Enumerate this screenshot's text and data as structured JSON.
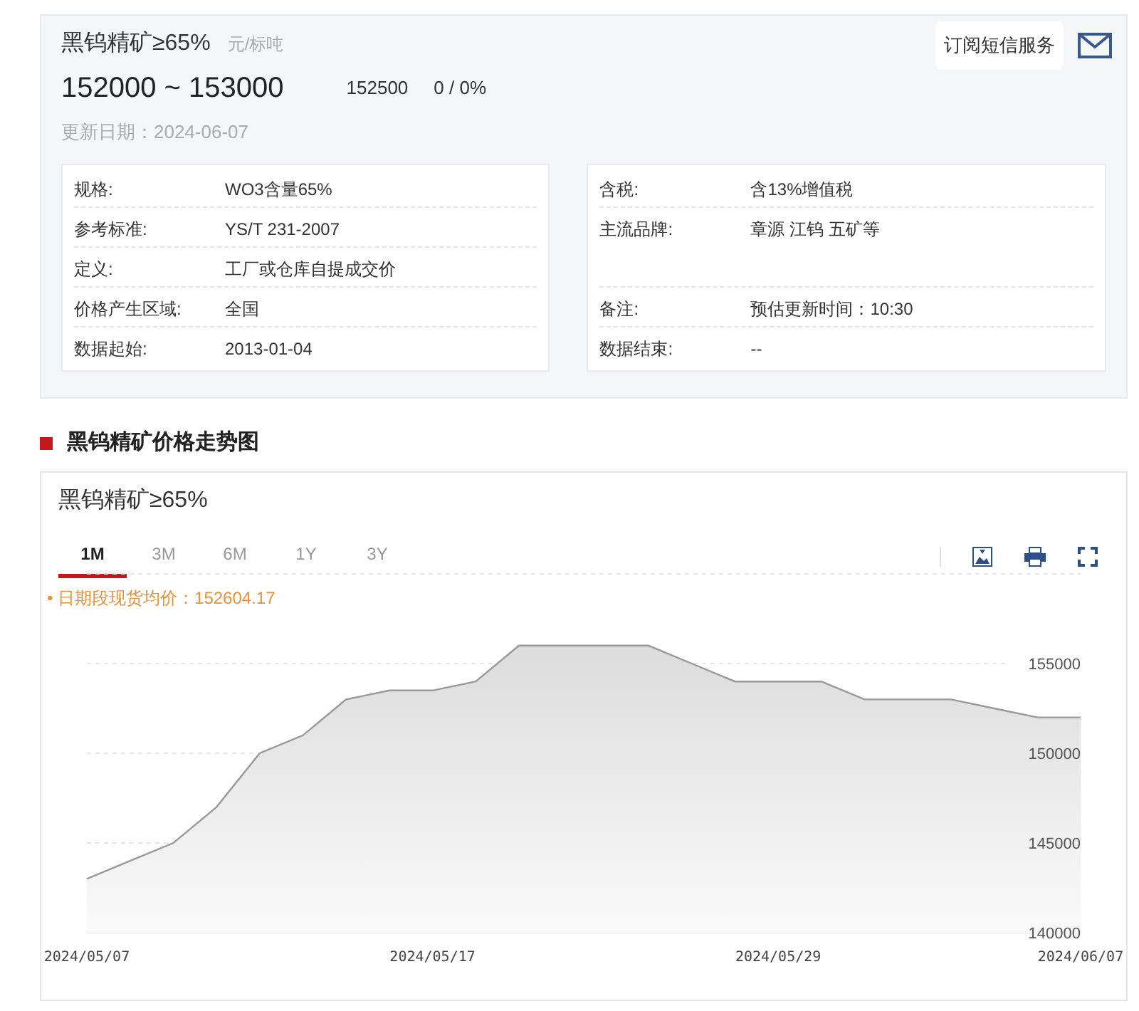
{
  "header": {
    "title": "黑钨精矿≥65%",
    "unit": "元/标吨",
    "price_range": "152000 ~ 153000",
    "average": "152500",
    "change": "0 / 0%",
    "updated": "更新日期：2024-06-07",
    "subscribe_button": "订阅短信服务"
  },
  "info_left": [
    {
      "label": "规格:",
      "value": "WO3含量65%"
    },
    {
      "label": "参考标准:",
      "value": "YS/T 231-2007"
    },
    {
      "label": "定义:",
      "value": "工厂或仓库自提成交价"
    },
    {
      "label": "价格产生区域:",
      "value": "全国"
    },
    {
      "label": "数据起始:",
      "value": "2013-01-04"
    }
  ],
  "info_right": [
    {
      "label": "含税:",
      "value": "含13%增值税",
      "kind": "normal"
    },
    {
      "label": "主流品牌:",
      "value": "章源 江钨 五矿等",
      "kind": "tall"
    },
    {
      "label": "备注:",
      "value": "预估更新时间：10:30",
      "kind": "normal"
    },
    {
      "label": "数据结束:",
      "value": "--",
      "kind": "normal"
    }
  ],
  "section_title": "黑钨精矿价格走势图",
  "chart_panel": {
    "title": "黑钨精矿≥65%",
    "tabs": [
      {
        "label": "1M",
        "selected": true
      },
      {
        "label": "3M",
        "selected": false
      },
      {
        "label": "6M",
        "selected": false
      },
      {
        "label": "1Y",
        "selected": false
      },
      {
        "label": "3Y",
        "selected": false
      }
    ],
    "average_note": "• 日期段现货均价：152604.17",
    "chart_data": {
      "type": "area",
      "categories": [
        "2024/05/07",
        null,
        null,
        null,
        null,
        null,
        null,
        null,
        "2024/05/17",
        null,
        null,
        null,
        null,
        null,
        null,
        null,
        "2024/05/29",
        null,
        null,
        null,
        null,
        null,
        null,
        "2024/06/07"
      ],
      "series": [
        {
          "color": "#999999",
          "values": [
            143000,
            144000,
            145000,
            147000,
            150000,
            151000,
            153000,
            153500,
            153500,
            154000,
            156000,
            156000,
            156000,
            156000,
            155000,
            154000,
            154000,
            154000,
            153000,
            153000,
            153000,
            152500,
            152000,
            152000
          ]
        }
      ],
      "ylim": [
        140000,
        160000
      ],
      "grid": true,
      "yticks": [
        140000,
        145000,
        150000,
        155000
      ]
    }
  }
}
